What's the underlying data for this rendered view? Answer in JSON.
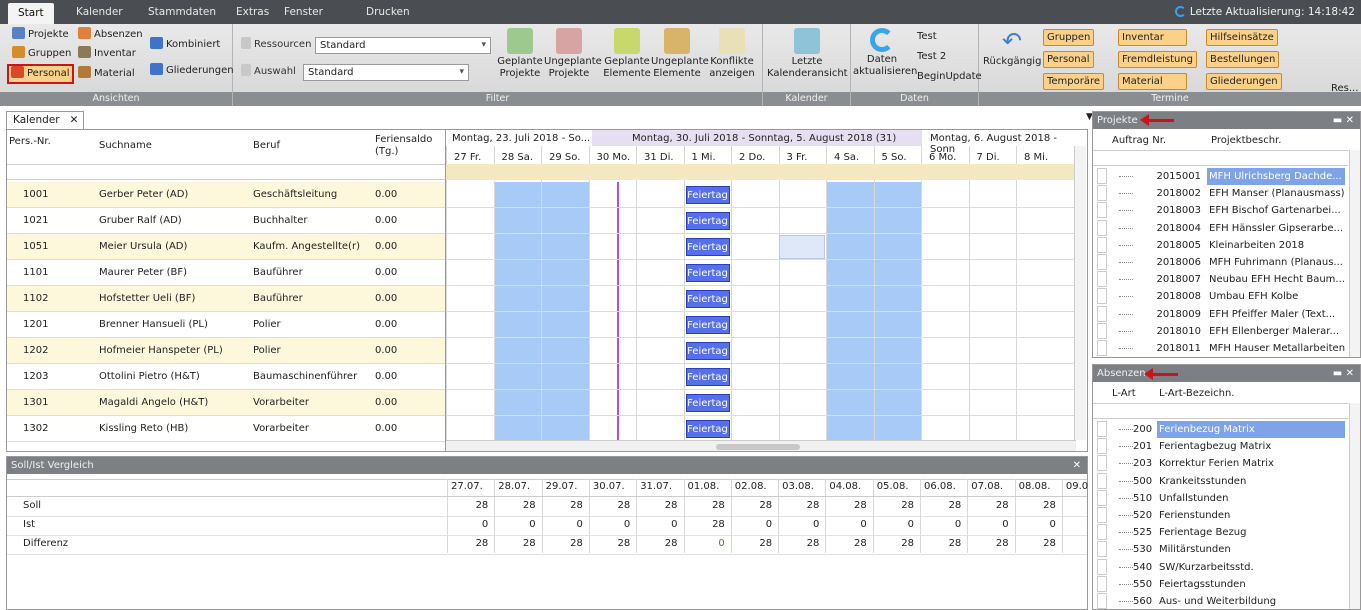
{
  "menu": {
    "tabs": [
      "Start",
      "Kalender",
      "Stammdaten",
      "Extras",
      "Fenster",
      "Drucken"
    ],
    "last_update": "Letzte Aktualisierung: 14:18:42"
  },
  "ribbon": {
    "ansichten": {
      "caption": "Ansichten",
      "projekte": "Projekte",
      "absenzen": "Absenzen",
      "kombiniert": "Kombiniert",
      "gruppen": "Gruppen",
      "inventar": "Inventar",
      "personal": "Personal",
      "material": "Material",
      "gliederungen": "Gliederungen"
    },
    "filter": {
      "caption": "Filter",
      "ressourcen_label": "Ressourcen",
      "ressourcen_value": "Standard",
      "auswahl_label": "Auswahl",
      "auswahl_value": "Standard",
      "b1": "Geplante Projekte",
      "b2": "Ungeplante Projekte",
      "b3": "Geplante Elemente",
      "b4": "Ungeplante Elemente",
      "b5": "Konflikte anzeigen"
    },
    "kalender": {
      "caption": "Kalender",
      "b1": "Letzte Kalenderansicht"
    },
    "daten": {
      "caption": "Daten",
      "b1": "Daten aktualisieren",
      "test": "Test",
      "test2": "Test 2",
      "beginupdate": "BeginUpdate"
    },
    "termine": {
      "caption": "Termine",
      "rueck": "Rückgängig",
      "gruppen": "Gruppen",
      "inventar": "Inventar",
      "hilfseinsatz": "Hilfseinsätze",
      "personal": "Personal",
      "fremdleistung": "Fremdleistung",
      "bestellungen": "Bestellungen",
      "temporaere": "Temporäre",
      "material": "Material",
      "gliederungen": "Gliederungen",
      "res": "Res..."
    }
  },
  "calendar": {
    "tab": "Kalender",
    "cols": {
      "nr": "Pers.-Nr.",
      "such": "Suchname",
      "beruf": "Beruf",
      "saldo": "Feriensaldo (Tg.)"
    },
    "weeks": [
      "Montag, 23. Juli 2018 - So...",
      "Montag, 30. Juli 2018 - Sonntag, 5. August 2018 (31)",
      "Montag, 6. August 2018 - Sonn"
    ],
    "days": [
      "27 Fr.",
      "28 Sa.",
      "29 So.",
      "30 Mo.",
      "31 Di.",
      "1 Mi.",
      "2 Do.",
      "3 Fr.",
      "4 Sa.",
      "5 So.",
      "6 Mo.",
      "7 Di.",
      "8 Mi."
    ],
    "holiday": "Feiertag",
    "rows": [
      {
        "nr": "1001",
        "name": "Gerber Peter (AD)",
        "beruf": "Geschäftsleitung",
        "saldo": "0.00"
      },
      {
        "nr": "1021",
        "name": "Gruber Ralf (AD)",
        "beruf": "Buchhalter",
        "saldo": "0.00"
      },
      {
        "nr": "1051",
        "name": "Meier Ursula (AD)",
        "beruf": "Kaufm. Angestellte(r)",
        "saldo": "0.00"
      },
      {
        "nr": "1101",
        "name": "Maurer Peter (BF)",
        "beruf": "Bauführer",
        "saldo": "0.00"
      },
      {
        "nr": "1102",
        "name": "Hofstetter Ueli (BF)",
        "beruf": "Bauführer",
        "saldo": "0.00"
      },
      {
        "nr": "1201",
        "name": "Brenner Hansueli (PL)",
        "beruf": "Polier",
        "saldo": "0.00"
      },
      {
        "nr": "1202",
        "name": "Hofmeier Hanspeter (PL)",
        "beruf": "Polier",
        "saldo": "0.00"
      },
      {
        "nr": "1203",
        "name": "Ottolini Pietro (H&T)",
        "beruf": "Baumaschinenführer",
        "saldo": "0.00"
      },
      {
        "nr": "1301",
        "name": "Magaldi Angelo (H&T)",
        "beruf": "Vorarbeiter",
        "saldo": "0.00"
      },
      {
        "nr": "1302",
        "name": "Kissling Reto (HB)",
        "beruf": "Vorarbeiter",
        "saldo": "0.00"
      }
    ]
  },
  "soll": {
    "title": "Soll/Ist Vergleich",
    "dates": [
      "27.07.",
      "28.07.",
      "29.07.",
      "30.07.",
      "31.07.",
      "01.08.",
      "02.08.",
      "03.08.",
      "04.08.",
      "05.08.",
      "06.08.",
      "07.08.",
      "08.08.",
      "09.0"
    ],
    "rows": [
      {
        "label": "Soll",
        "values": [
          "28",
          "28",
          "28",
          "28",
          "28",
          "28",
          "28",
          "28",
          "28",
          "28",
          "28",
          "28",
          "28"
        ]
      },
      {
        "label": "Ist",
        "values": [
          "0",
          "0",
          "0",
          "0",
          "0",
          "28",
          "0",
          "0",
          "0",
          "0",
          "0",
          "0",
          "0"
        ]
      },
      {
        "label": "Differenz",
        "values": [
          "28",
          "28",
          "28",
          "28",
          "28",
          "0",
          "28",
          "28",
          "28",
          "28",
          "28",
          "28",
          "28"
        ]
      }
    ]
  },
  "projekte": {
    "title": "Projekte",
    "cols": [
      "Auftrag Nr.",
      "Projektbeschr."
    ],
    "rows": [
      {
        "nr": "2015001",
        "desc": "MFH Ulrichsberg Dachde..."
      },
      {
        "nr": "2018002",
        "desc": "EFH Manser (Planausmass)"
      },
      {
        "nr": "2018003",
        "desc": "EFH Bischof Gartenarbei..."
      },
      {
        "nr": "2018004",
        "desc": "EFH Hänssler Gipserarbe..."
      },
      {
        "nr": "2018005",
        "desc": "Kleinarbeiten 2018"
      },
      {
        "nr": "2018006",
        "desc": "MFH Fuhrimann (Planaus..."
      },
      {
        "nr": "2018007",
        "desc": "Neubau EFH Hecht Baum..."
      },
      {
        "nr": "2018008",
        "desc": "Umbau EFH Kolbe"
      },
      {
        "nr": "2018009",
        "desc": "EFH Pfeiffer Maler (Text..."
      },
      {
        "nr": "2018010",
        "desc": "EFH Ellenberger Malerar..."
      },
      {
        "nr": "2018011",
        "desc": "MFH Hauser Metallarbeiten"
      }
    ]
  },
  "absenzen": {
    "title": "Absenzen",
    "cols": [
      "L-Art",
      "L-Art-Bezeichn."
    ],
    "rows": [
      {
        "nr": "200",
        "desc": "Ferienbezug Matrix"
      },
      {
        "nr": "201",
        "desc": "Ferientagbezug Matrix"
      },
      {
        "nr": "203",
        "desc": "Korrektur Ferien Matrix"
      },
      {
        "nr": "500",
        "desc": "Krankeitsstunden"
      },
      {
        "nr": "510",
        "desc": "Unfallstunden"
      },
      {
        "nr": "520",
        "desc": "Ferienstunden"
      },
      {
        "nr": "525",
        "desc": "Ferientage Bezug"
      },
      {
        "nr": "530",
        "desc": "Militärstunden"
      },
      {
        "nr": "540",
        "desc": "SW/Kurzarbeitsstd."
      },
      {
        "nr": "550",
        "desc": "Feiertagsstunden"
      },
      {
        "nr": "560",
        "desc": "Aus- und Weiterbildung"
      }
    ]
  }
}
